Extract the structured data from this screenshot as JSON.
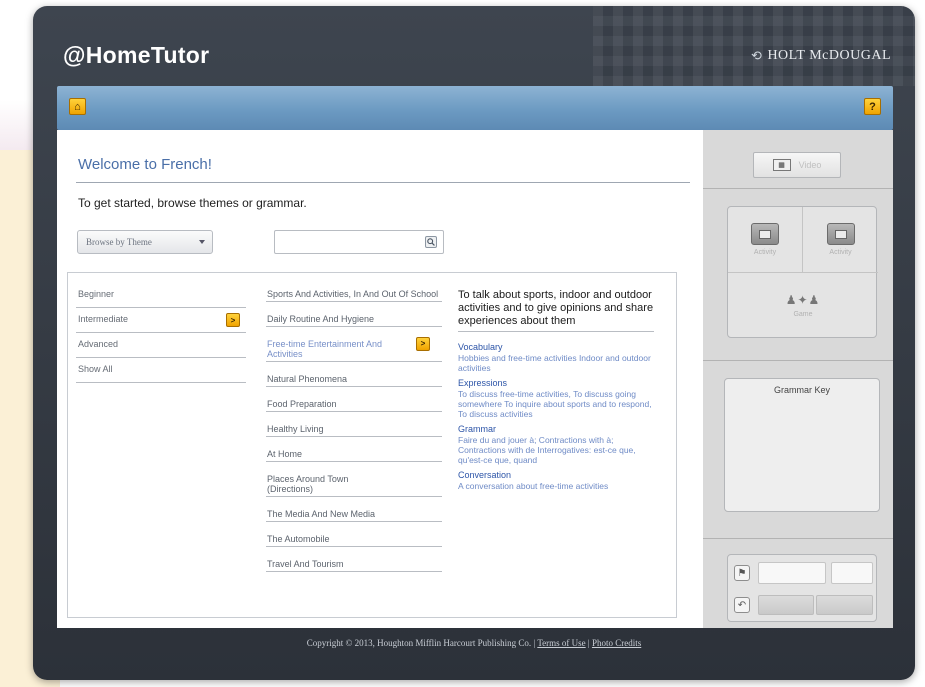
{
  "app": {
    "logo": "@HomeTutor",
    "publisher": "HOLT McDOUGAL",
    "publisher_mark_icon": "holt-swirl-icon"
  },
  "toolbar": {
    "home_icon": "home-icon",
    "home_glyph": "⌂",
    "help_label": "?"
  },
  "main": {
    "welcome_title": "Welcome to French!",
    "intro_text": "To get started, browse themes or grammar.",
    "browse_select_value": "Browse by Theme",
    "search_placeholder": "",
    "levels": [
      {
        "label": "Beginner"
      },
      {
        "label": "Intermediate",
        "has_arrow": true
      },
      {
        "label": "Advanced"
      },
      {
        "label": "Show All"
      }
    ],
    "themes": [
      "Sports And Activities, In And Out Of School",
      "Daily Routine And Hygiene",
      "Free-time Entertainment And Activities",
      "Natural Phenomena",
      "Food Preparation",
      "Healthy Living",
      "At Home",
      "Places Around Town (Directions)",
      "The Media And New Media",
      "The Automobile",
      "Travel And Tourism"
    ],
    "detail": {
      "title": "To talk about sports, indoor and outdoor activities and to give opinions and share experiences about them",
      "sections": [
        {
          "heading": "Vocabulary",
          "body": "Hobbies and free-time activities Indoor and outdoor activities"
        },
        {
          "heading": "Expressions",
          "body": "To discuss free-time activities, To discuss going somewhere To inquire about sports and to respond, To discuss activities"
        },
        {
          "heading": "Grammar",
          "body": "Faire du and jouer à; Contractions with à; Contractions with de Interrogatives: est-ce que, qu'est-ce que, quand"
        },
        {
          "heading": "Conversation",
          "body": "A conversation about free-time activities"
        }
      ]
    }
  },
  "right_panel": {
    "video_label": "Video",
    "activity_label_1": "Activity",
    "activity_label_2": "Activity",
    "game_label": "Game",
    "grammar_key_title": "Grammar Key"
  },
  "footer": {
    "copyright": "Copyright © 2013, Houghton Mifflin Harcourt Publishing Co. |",
    "terms_link": "Terms of Use",
    "separator": "|",
    "photo_link": "Photo Credits"
  },
  "colors": {
    "frame": "#363c45",
    "toolbar": "#6c9ac2",
    "accent_button": "#f0a300",
    "title_blue": "#4a6fa8",
    "link_blue": "#2d55a8"
  }
}
